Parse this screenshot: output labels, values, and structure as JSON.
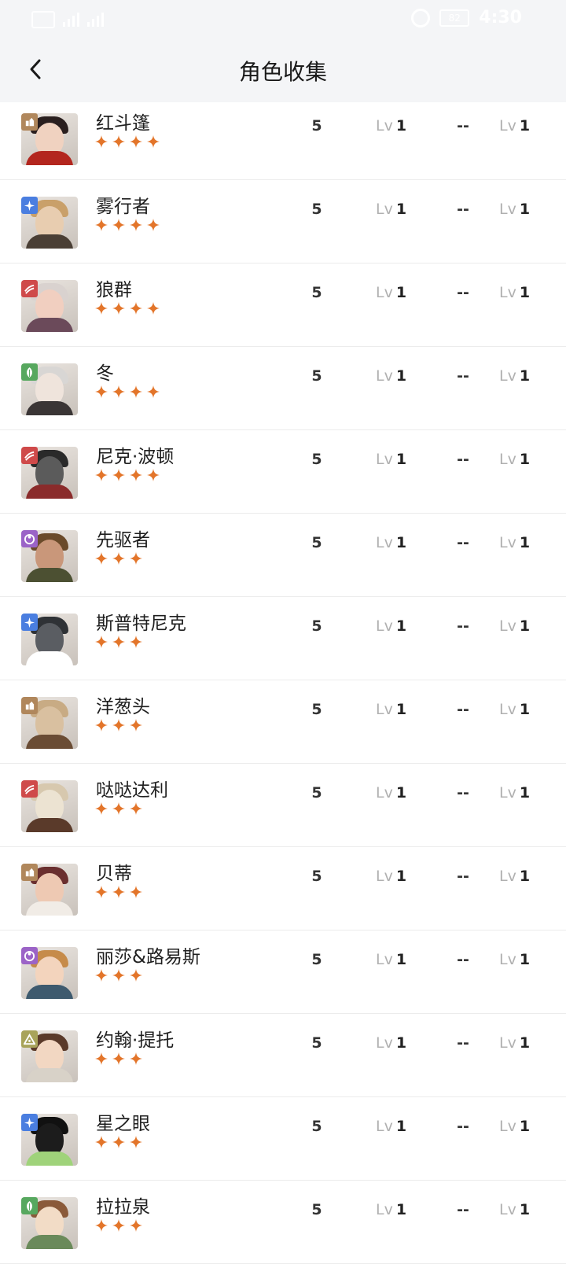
{
  "status_bar": {
    "battery": "82",
    "time": "4:30"
  },
  "header": {
    "title": "角色收集"
  },
  "colors": {
    "star": "#e3752a",
    "badge_brown": "#b0875c",
    "badge_blue": "#4a7ee0",
    "badge_red": "#cf4a4a",
    "badge_green": "#57a85f",
    "badge_purple": "#9b63c7",
    "badge_olive": "#a8a35a"
  },
  "characters": [
    {
      "name": "红斗篷",
      "stars": 4,
      "badge": "brown",
      "icon": "rock-icon",
      "count": "5",
      "lv_label": "Lv",
      "level": "1",
      "extra": "--",
      "lv2_label": "Lv",
      "level2": "1",
      "skin": "#f0d2c0",
      "hair": "#2a1f1f",
      "body": "#b3261e"
    },
    {
      "name": "雾行者",
      "stars": 4,
      "badge": "blue",
      "icon": "star-icon",
      "count": "5",
      "lv_label": "Lv",
      "level": "1",
      "extra": "--",
      "lv2_label": "Lv",
      "level2": "1",
      "skin": "#e8cdb0",
      "hair": "#c9a06a",
      "body": "#4a3f35"
    },
    {
      "name": "狼群",
      "stars": 4,
      "badge": "red",
      "icon": "claw-icon",
      "count": "5",
      "lv_label": "Lv",
      "level": "1",
      "extra": "--",
      "lv2_label": "Lv",
      "level2": "1",
      "skin": "#f1cfc0",
      "hair": "#d9d2cf",
      "body": "#6b4a5a"
    },
    {
      "name": "冬",
      "stars": 4,
      "badge": "green",
      "icon": "leaf-icon",
      "count": "5",
      "lv_label": "Lv",
      "level": "1",
      "extra": "--",
      "lv2_label": "Lv",
      "level2": "1",
      "skin": "#efe4dc",
      "hair": "#d8d6d4",
      "body": "#3a3535"
    },
    {
      "name": "尼克·波顿",
      "stars": 4,
      "badge": "red",
      "icon": "claw-icon",
      "count": "5",
      "lv_label": "Lv",
      "level": "1",
      "extra": "--",
      "lv2_label": "Lv",
      "level2": "1",
      "skin": "#5b5b5b",
      "hair": "#2a2a2a",
      "body": "#8a2b2b"
    },
    {
      "name": "先驱者",
      "stars": 3,
      "badge": "purple",
      "icon": "moon-icon",
      "count": "5",
      "lv_label": "Lv",
      "level": "1",
      "extra": "--",
      "lv2_label": "Lv",
      "level2": "1",
      "skin": "#c9977a",
      "hair": "#6a4a2a",
      "body": "#4c5032"
    },
    {
      "name": "斯普特尼克",
      "stars": 3,
      "badge": "blue",
      "icon": "star-icon",
      "count": "5",
      "lv_label": "Lv",
      "level": "1",
      "extra": "--",
      "lv2_label": "Lv",
      "level2": "1",
      "skin": "#5a5d62",
      "hair": "#2f3236",
      "body": "#ffffff"
    },
    {
      "name": "洋葱头",
      "stars": 3,
      "badge": "brown",
      "icon": "rock-icon",
      "count": "5",
      "lv_label": "Lv",
      "level": "1",
      "extra": "--",
      "lv2_label": "Lv",
      "level2": "1",
      "skin": "#d9c0a0",
      "hair": "#c8ab84",
      "body": "#6a4c34"
    },
    {
      "name": "哒哒达利",
      "stars": 3,
      "badge": "red",
      "icon": "claw-icon",
      "count": "5",
      "lv_label": "Lv",
      "level": "1",
      "extra": "--",
      "lv2_label": "Lv",
      "level2": "1",
      "skin": "#ece3d2",
      "hair": "#d7c8ae",
      "body": "#5a3a2a"
    },
    {
      "name": "贝蒂",
      "stars": 3,
      "badge": "brown",
      "icon": "rock-icon",
      "count": "5",
      "lv_label": "Lv",
      "level": "1",
      "extra": "--",
      "lv2_label": "Lv",
      "level2": "1",
      "skin": "#eec9b3",
      "hair": "#6a2f2f",
      "body": "#f1ece6"
    },
    {
      "name": "丽莎&路易斯",
      "stars": 3,
      "badge": "purple",
      "icon": "moon-icon",
      "count": "5",
      "lv_label": "Lv",
      "level": "1",
      "extra": "--",
      "lv2_label": "Lv",
      "level2": "1",
      "skin": "#f3d4bd",
      "hair": "#c68b4a",
      "body": "#3e5a6e"
    },
    {
      "name": "约翰·提托",
      "stars": 3,
      "badge": "olive",
      "icon": "triangle-icon",
      "count": "5",
      "lv_label": "Lv",
      "level": "1",
      "extra": "--",
      "lv2_label": "Lv",
      "level2": "1",
      "skin": "#f2d7c2",
      "hair": "#5a3a2a",
      "body": "#d8d2c8"
    },
    {
      "name": "星之眼",
      "stars": 3,
      "badge": "blue",
      "icon": "star-icon",
      "count": "5",
      "lv_label": "Lv",
      "level": "1",
      "extra": "--",
      "lv2_label": "Lv",
      "level2": "1",
      "skin": "#1c1c1c",
      "hair": "#111111",
      "body": "#9fd37a"
    },
    {
      "name": "拉拉泉",
      "stars": 3,
      "badge": "green",
      "icon": "leaf-icon",
      "count": "5",
      "lv_label": "Lv",
      "level": "1",
      "extra": "--",
      "lv2_label": "Lv",
      "level2": "1",
      "skin": "#f2dcc6",
      "hair": "#8a5a3a",
      "body": "#6a8a5a"
    }
  ]
}
